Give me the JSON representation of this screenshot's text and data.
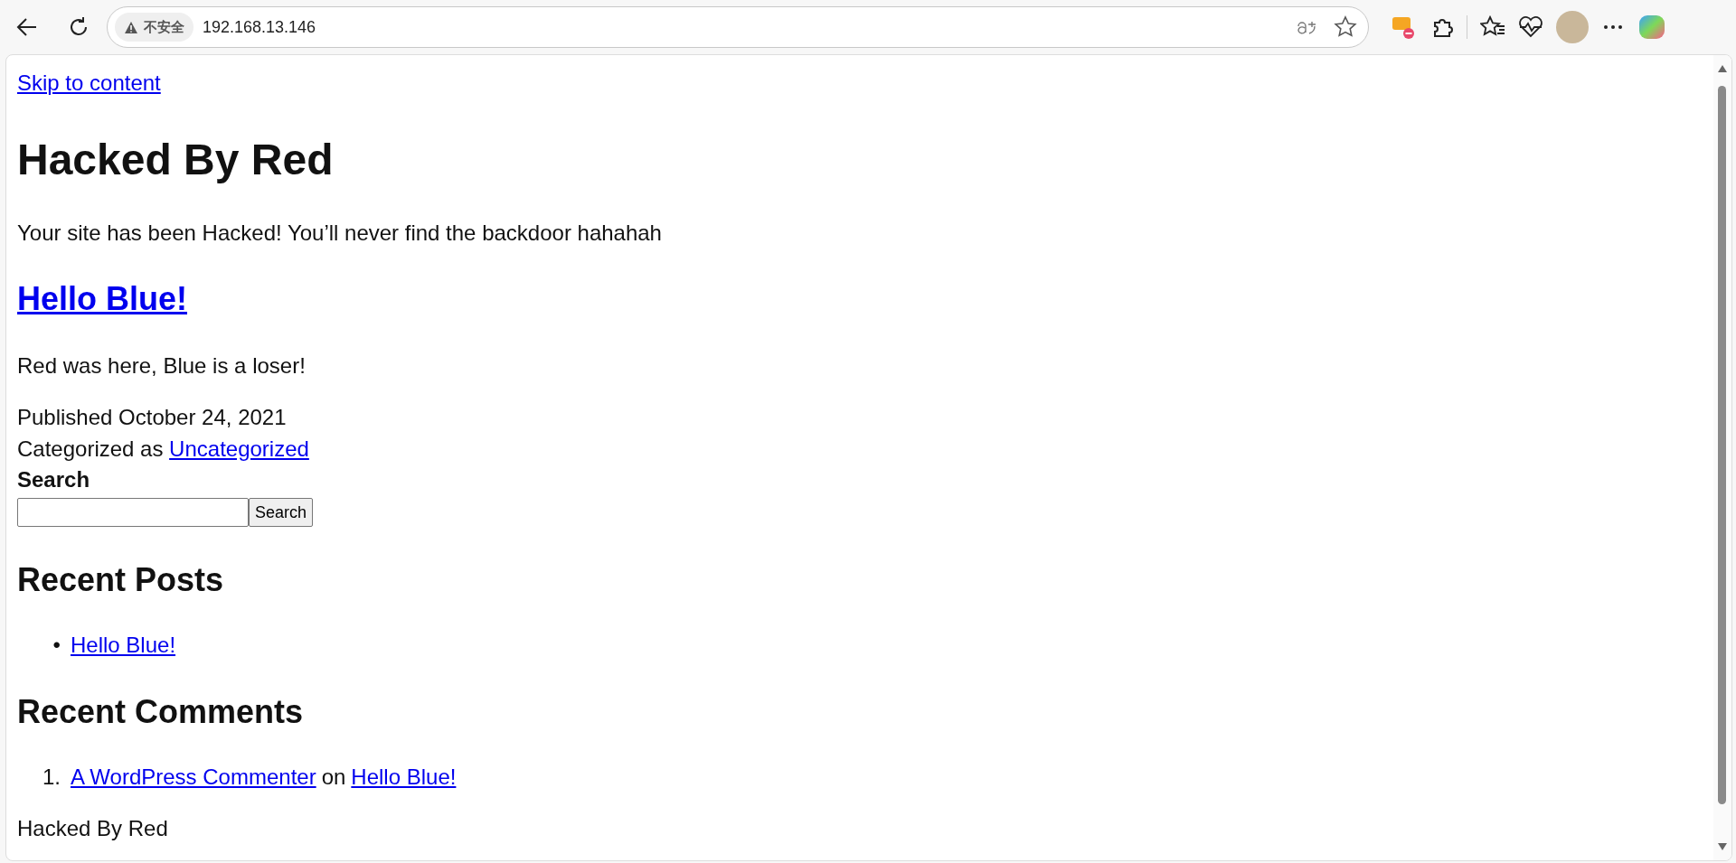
{
  "browser": {
    "security_label": "不安全",
    "url": "192.168.13.146"
  },
  "page": {
    "skip_link": "Skip to content",
    "site_title": "Hacked By Red",
    "tagline": "Your site has been Hacked! You’ll never find the backdoor hahahah",
    "post": {
      "title": "Hello Blue!",
      "content": "Red was here, Blue is a loser!",
      "published": "Published October 24, 2021",
      "category_prefix": "Categorized as",
      "category": "Uncategorized"
    },
    "search": {
      "label": "Search",
      "button": "Search"
    },
    "recent_posts": {
      "heading": "Recent Posts",
      "items": [
        {
          "marker": "•",
          "title": "Hello Blue!"
        }
      ]
    },
    "recent_comments": {
      "heading": "Recent Comments",
      "items": [
        {
          "marker": "1.",
          "author": "A WordPress Commenter",
          "joiner": "on",
          "post": "Hello Blue!"
        }
      ]
    },
    "footer": "Hacked By Red"
  }
}
